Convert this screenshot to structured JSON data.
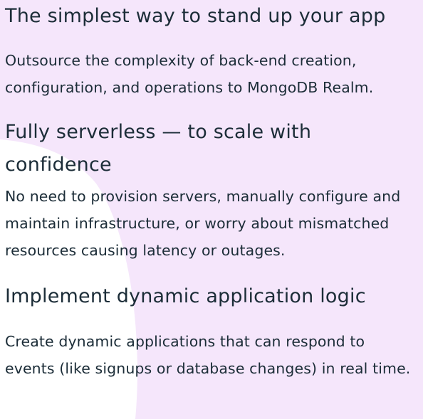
{
  "sections": [
    {
      "heading": "The simplest way to stand up your app",
      "body": "Outsource the complexity of back-end creation, configuration, and operations to MongoDB Realm."
    },
    {
      "heading": "Fully serverless — to scale with confidence",
      "body": "No need to provision servers, manually configure and maintain infrastructure, or worry about mismatched resources causing latency or outages."
    },
    {
      "heading": "Implement dynamic application logic",
      "body": "Create dynamic applications that can respond to events (like signups or database changes) in real time."
    }
  ],
  "colors": {
    "text": "#1c2d38",
    "background": "#ffffff",
    "accent_shape": "#f5e6fb"
  }
}
